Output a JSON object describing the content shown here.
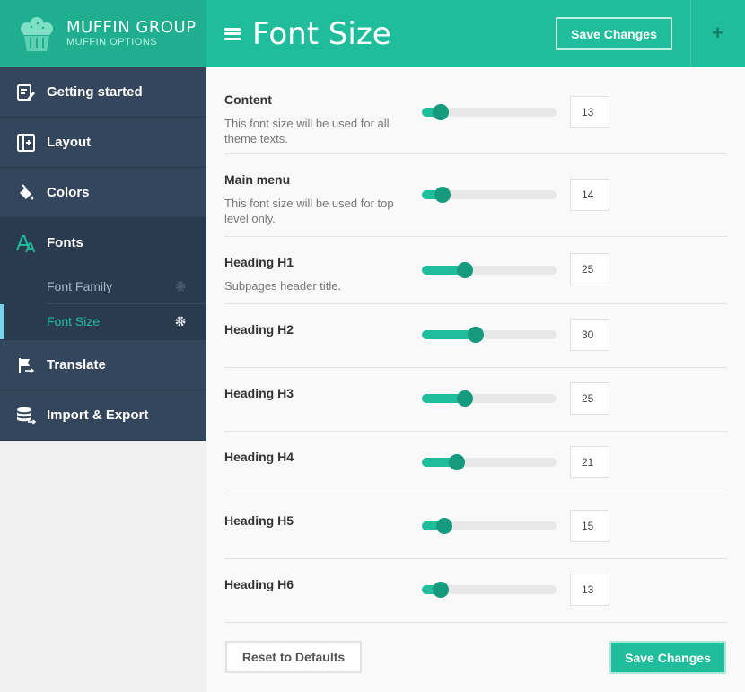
{
  "brand": {
    "name": "MUFFIN GROUP",
    "subtitle": "MUFFIN OPTIONS"
  },
  "header": {
    "title": "Font Size",
    "save_label": "Save Changes",
    "add_label": "+"
  },
  "sidebar": {
    "items": [
      {
        "label": "Getting started",
        "icon": "edit-icon"
      },
      {
        "label": "Layout",
        "icon": "layout-icon"
      },
      {
        "label": "Colors",
        "icon": "paint-bucket-icon"
      },
      {
        "label": "Fonts",
        "icon": "fonts-icon"
      },
      {
        "label": "Translate",
        "icon": "flag-icon"
      },
      {
        "label": "Import & Export",
        "icon": "database-icon"
      }
    ],
    "font_subitems": [
      {
        "label": "Font Family"
      },
      {
        "label": "Font Size"
      }
    ]
  },
  "settings": [
    {
      "label": "Content",
      "description": "This font size will be used for all theme texts.",
      "value": "13",
      "level": 0.14
    },
    {
      "label": "Main menu",
      "description": "This font size will be used for top level only.",
      "value": "14",
      "level": 0.155
    },
    {
      "label": "Heading H1",
      "description": "Subpages header title.",
      "value": "25",
      "level": 0.32
    },
    {
      "label": "Heading H2",
      "description": "",
      "value": "30",
      "level": 0.4
    },
    {
      "label": "Heading H3",
      "description": "",
      "value": "25",
      "level": 0.32
    },
    {
      "label": "Heading H4",
      "description": "",
      "value": "21",
      "level": 0.26
    },
    {
      "label": "Heading H5",
      "description": "",
      "value": "15",
      "level": 0.165
    },
    {
      "label": "Heading H6",
      "description": "",
      "value": "13",
      "level": 0.14
    }
  ],
  "footer": {
    "reset_label": "Reset to Defaults",
    "save_label": "Save Changes"
  },
  "colors": {
    "accent": "#1fbd9b",
    "sidebar": "#34465c",
    "knob": "#159a7e"
  }
}
